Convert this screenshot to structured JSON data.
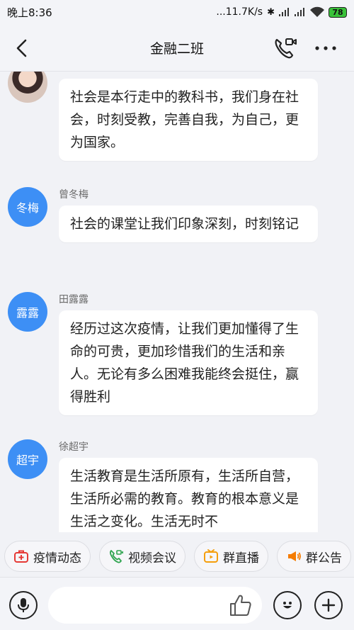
{
  "status": {
    "time": "晚上8:36",
    "network_speed": "...11.7K/s",
    "battery_level": "78"
  },
  "header": {
    "title": "金融二班"
  },
  "messages": [
    {
      "sender": "",
      "avatar_text": "",
      "text": "社会是本行走中的教科书，我们身在社会，时刻受教，完善自我，为自己，更为国家。"
    },
    {
      "sender": "曾冬梅",
      "avatar_text": "冬梅",
      "text": "社会的课堂让我们印象深刻，时刻铭记"
    },
    {
      "sender": "田露露",
      "avatar_text": "露露",
      "text": "经历过这次疫情，让我们更加懂得了生命的可贵，更加珍惜我们的生活和亲人。无论有多么困难我能终会挺住，赢得胜利"
    },
    {
      "sender": "徐超宇",
      "avatar_text": "超宇",
      "text": "生活教育是生活所原有，生活所自营，生活所必需的教育。教育的根本意义是生活之变化。生活无时不"
    }
  ],
  "quick_actions": [
    {
      "label": "疫情动态",
      "icon": "medkit-icon",
      "color": "#e53935"
    },
    {
      "label": "视频会议",
      "icon": "video-phone-icon",
      "color": "#2ea44f"
    },
    {
      "label": "群直播",
      "icon": "tv-icon",
      "color": "#f59e0b"
    },
    {
      "label": "群公告",
      "icon": "megaphone-icon",
      "color": "#f57c00"
    }
  ],
  "input": {
    "placeholder": ""
  },
  "colors": {
    "avatar_blue": "#3d8ff5",
    "background": "#f1f2f6"
  }
}
